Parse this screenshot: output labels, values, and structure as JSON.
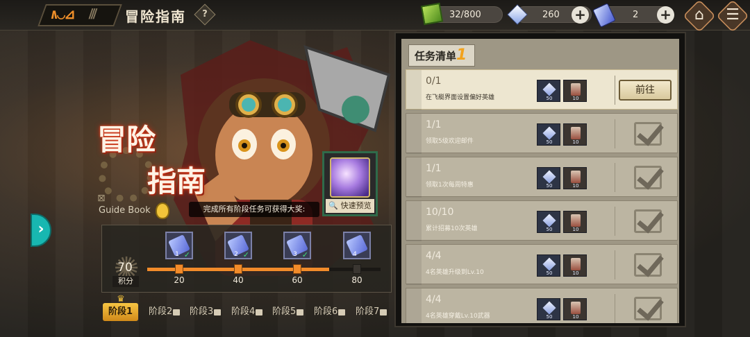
{
  "header": {
    "title": "冒险指南",
    "help_label": "?",
    "stamina": "32/800",
    "crystals": "260",
    "tickets": "2"
  },
  "guide": {
    "big_title_line1": "冒险",
    "big_title_line2": "指南",
    "guide_book_label": "Guide Book",
    "reward_note": "完成所有阶段任务可获得大奖:",
    "preview_label": "快速预览"
  },
  "progress": {
    "score": "70",
    "score_label": "积分",
    "score_fraction": 0.78,
    "milestones": [
      {
        "label": "20",
        "item_num": "1",
        "claimed": true
      },
      {
        "label": "40",
        "item_num": "2",
        "claimed": true
      },
      {
        "label": "60",
        "item_num": "3",
        "claimed": true
      },
      {
        "label": "80",
        "item_num": "4",
        "claimed": false
      }
    ]
  },
  "stages": [
    {
      "label": "阶段1",
      "active": true,
      "locked": false
    },
    {
      "label": "阶段2",
      "active": false,
      "locked": true
    },
    {
      "label": "阶段3",
      "active": false,
      "locked": true
    },
    {
      "label": "阶段4",
      "active": false,
      "locked": true
    },
    {
      "label": "阶段5",
      "active": false,
      "locked": true
    },
    {
      "label": "阶段6",
      "active": false,
      "locked": true
    },
    {
      "label": "阶段7",
      "active": false,
      "locked": true
    }
  ],
  "tasks": {
    "header_label": "任务清单",
    "header_num": "1",
    "goto_label": "前往",
    "reward_counts": [
      "50",
      "10"
    ],
    "items": [
      {
        "progress": "0/1",
        "desc": "在飞艇界面设置偏好英雄",
        "done": false
      },
      {
        "progress": "1/1",
        "desc": "领取5级欢迎邮件",
        "done": true
      },
      {
        "progress": "1/1",
        "desc": "领取1次每周特惠",
        "done": true
      },
      {
        "progress": "10/10",
        "desc": "累计招募10次英雄",
        "done": true
      },
      {
        "progress": "4/4",
        "desc": "4名英雄升级到Lv.10",
        "done": true
      },
      {
        "progress": "4/4",
        "desc": "4名英雄穿戴Lv.10武器",
        "done": true
      }
    ]
  },
  "colors": {
    "accent": "#f28b2a",
    "active_tab": "#f6c543",
    "teal": "#18b7b1"
  }
}
